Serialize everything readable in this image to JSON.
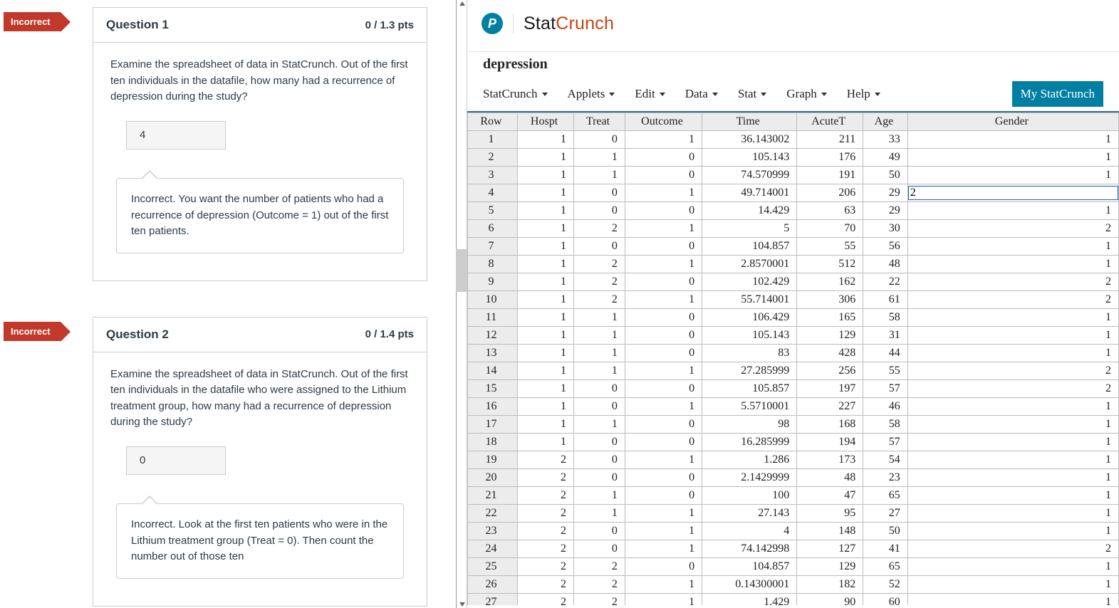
{
  "quiz": {
    "flag_label": "Incorrect",
    "questions": [
      {
        "title": "Question 1",
        "points": "0 / 1.3 pts",
        "prompt": "Examine the spreadsheet of data in StatCrunch. Out of the first ten individuals in the datafile, how many had a recurrence of depression during the study?",
        "answer": "4",
        "feedback": "Incorrect. You want the number of patients who had a recurrence of depression (Outcome = 1) out of the first ten patients."
      },
      {
        "title": "Question 2",
        "points": "0 / 1.4 pts",
        "prompt": "Examine the spreadsheet of data in StatCrunch. Out of the first ten individuals in the datafile who were assigned to the Lithium treatment group, how many had a recurrence of depression during the study?",
        "answer": "0",
        "feedback": "Incorrect. Look at the first ten patients who were in the Lithium treatment group (Treat = 0). Then count the number out of those ten"
      }
    ]
  },
  "statcrunch": {
    "brand_black": "Stat",
    "brand_orange": "Crunch",
    "dataset_title": "depression",
    "menus": [
      "StatCrunch",
      "Applets",
      "Edit",
      "Data",
      "Stat",
      "Graph",
      "Help"
    ],
    "my_btn": "My StatCrunch",
    "columns": [
      "Row",
      "Hospt",
      "Treat",
      "Outcome",
      "Time",
      "AcuteT",
      "Age",
      "Gender"
    ],
    "active_cell": {
      "row_index": 3,
      "col_index": 7,
      "value": "2"
    },
    "rows": [
      [
        1,
        1,
        0,
        1,
        "36.143002",
        211,
        33,
        1
      ],
      [
        2,
        1,
        1,
        0,
        "105.143",
        176,
        49,
        1
      ],
      [
        3,
        1,
        1,
        0,
        "74.570999",
        191,
        50,
        1
      ],
      [
        4,
        1,
        0,
        1,
        "49.714001",
        206,
        29,
        ""
      ],
      [
        5,
        1,
        0,
        0,
        "14.429",
        63,
        29,
        1
      ],
      [
        6,
        1,
        2,
        1,
        "5",
        70,
        30,
        2
      ],
      [
        7,
        1,
        0,
        0,
        "104.857",
        55,
        56,
        1
      ],
      [
        8,
        1,
        2,
        1,
        "2.8570001",
        512,
        48,
        1
      ],
      [
        9,
        1,
        2,
        0,
        "102.429",
        162,
        22,
        2
      ],
      [
        10,
        1,
        2,
        1,
        "55.714001",
        306,
        61,
        2
      ],
      [
        11,
        1,
        1,
        0,
        "106.429",
        165,
        58,
        1
      ],
      [
        12,
        1,
        1,
        0,
        "105.143",
        129,
        31,
        1
      ],
      [
        13,
        1,
        1,
        0,
        "83",
        428,
        44,
        1
      ],
      [
        14,
        1,
        1,
        1,
        "27.285999",
        256,
        55,
        2
      ],
      [
        15,
        1,
        0,
        0,
        "105.857",
        197,
        57,
        2
      ],
      [
        16,
        1,
        0,
        1,
        "5.5710001",
        227,
        46,
        1
      ],
      [
        17,
        1,
        1,
        0,
        "98",
        168,
        58,
        1
      ],
      [
        18,
        1,
        0,
        0,
        "16.285999",
        194,
        57,
        1
      ],
      [
        19,
        2,
        0,
        1,
        "1.286",
        173,
        54,
        1
      ],
      [
        20,
        2,
        0,
        0,
        "2.1429999",
        48,
        23,
        1
      ],
      [
        21,
        2,
        1,
        0,
        "100",
        47,
        65,
        1
      ],
      [
        22,
        2,
        1,
        1,
        "27.143",
        95,
        27,
        1
      ],
      [
        23,
        2,
        0,
        1,
        "4",
        148,
        50,
        1
      ],
      [
        24,
        2,
        0,
        1,
        "74.142998",
        127,
        41,
        2
      ],
      [
        25,
        2,
        2,
        0,
        "104.857",
        129,
        65,
        1
      ],
      [
        26,
        2,
        2,
        1,
        "0.14300001",
        182,
        52,
        1
      ],
      [
        27,
        2,
        2,
        1,
        "1.429",
        90,
        60,
        1
      ]
    ]
  }
}
